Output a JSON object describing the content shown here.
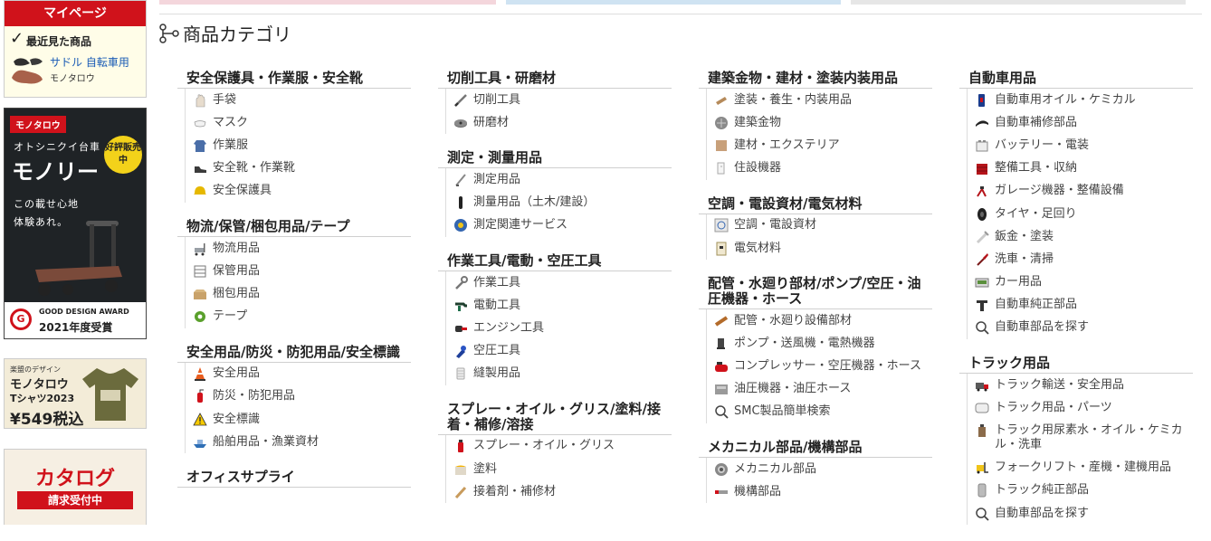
{
  "sidebar": {
    "mypage_label": "マイページ",
    "recent_label": "最近見た商品",
    "recent_item": {
      "name": "サドル 自転車用",
      "brand": "モノタロウ"
    },
    "banner_cart": {
      "logo": "モノタロウ",
      "subtitle": "オトシニクイ台車",
      "title": "モノリー",
      "badge": "好評販売中",
      "copy": "この載せ心地\n体験あれ。",
      "award_line1": "GOOD DESIGN AWARD",
      "award_line2": "2021年度受賞"
    },
    "banner_shirt": {
      "line1": "楽盟のデザイン",
      "line2": "モノタロウ",
      "line3": "Tシャツ2023",
      "price": "¥549税込"
    },
    "banner_catalog": {
      "title": "カタログ",
      "request": "請求受付中"
    }
  },
  "section": {
    "title": "商品カテゴリ"
  },
  "columns": [
    [
      {
        "title": "安全保護具・作業服・安全靴",
        "items": [
          {
            "label": "手袋",
            "icon": "glove-icon"
          },
          {
            "label": "マスク",
            "icon": "mask-icon"
          },
          {
            "label": "作業服",
            "icon": "workwear-icon"
          },
          {
            "label": "安全靴・作業靴",
            "icon": "shoe-icon"
          },
          {
            "label": "安全保護具",
            "icon": "helmet-icon"
          }
        ]
      },
      {
        "title": "物流/保管/梱包用品/テープ",
        "items": [
          {
            "label": "物流用品",
            "icon": "cart-icon"
          },
          {
            "label": "保管用品",
            "icon": "shelf-icon"
          },
          {
            "label": "梱包用品",
            "icon": "box-icon"
          },
          {
            "label": "テープ",
            "icon": "tape-icon"
          }
        ]
      },
      {
        "title": "安全用品/防災・防犯用品/安全標識",
        "items": [
          {
            "label": "安全用品",
            "icon": "cone-icon"
          },
          {
            "label": "防災・防犯用品",
            "icon": "extinguisher-icon"
          },
          {
            "label": "安全標識",
            "icon": "warning-sign-icon"
          },
          {
            "label": "船舶用品・漁業資材",
            "icon": "ship-icon"
          }
        ]
      },
      {
        "title": "オフィスサプライ",
        "items": []
      }
    ],
    [
      {
        "title": "切削工具・研磨材",
        "items": [
          {
            "label": "切削工具",
            "icon": "drill-bit-icon"
          },
          {
            "label": "研磨材",
            "icon": "grinding-disc-icon"
          }
        ]
      },
      {
        "title": "測定・測量用品",
        "items": [
          {
            "label": "測定用品",
            "icon": "caliper-icon"
          },
          {
            "label": "測量用品（土木/建設）",
            "icon": "survey-pole-icon"
          },
          {
            "label": "測定関連サービス",
            "icon": "service-icon"
          }
        ]
      },
      {
        "title": "作業工具/電動・空圧工具",
        "items": [
          {
            "label": "作業工具",
            "icon": "wrench-icon"
          },
          {
            "label": "電動工具",
            "icon": "power-drill-icon"
          },
          {
            "label": "エンジン工具",
            "icon": "chainsaw-icon"
          },
          {
            "label": "空圧工具",
            "icon": "air-tool-icon"
          },
          {
            "label": "縫製用品",
            "icon": "thread-icon"
          }
        ]
      },
      {
        "title": "スプレー・オイル・グリス/塗料/接着・補修/溶接",
        "items": [
          {
            "label": "スプレー・オイル・グリス",
            "icon": "spray-icon"
          },
          {
            "label": "塗料",
            "icon": "paint-icon"
          },
          {
            "label": "接着剤・補修材",
            "icon": "glue-icon"
          }
        ]
      }
    ],
    [
      {
        "title": "建築金物・建材・塗装内装用品",
        "items": [
          {
            "label": "塗装・養生・内装用品",
            "icon": "trowel-icon"
          },
          {
            "label": "建築金物",
            "icon": "hardware-icon"
          },
          {
            "label": "建材・エクステリア",
            "icon": "board-icon"
          },
          {
            "label": "住設機器",
            "icon": "faucet-icon"
          }
        ]
      },
      {
        "title": "空調・電設資材/電気材料",
        "items": [
          {
            "label": "空調・電設資材",
            "icon": "fan-icon"
          },
          {
            "label": "電気材料",
            "icon": "breaker-icon"
          }
        ]
      },
      {
        "title": "配管・水廻り部材/ポンプ/空圧・油圧機器・ホース",
        "items": [
          {
            "label": "配管・水廻り設備部材",
            "icon": "pipe-icon"
          },
          {
            "label": "ポンプ・送風機・電熱機器",
            "icon": "pump-icon"
          },
          {
            "label": "コンプレッサー・空圧機器・ホース",
            "icon": "compressor-icon"
          },
          {
            "label": "油圧機器・油圧ホース",
            "icon": "hydraulic-icon"
          },
          {
            "label": "SMC製品簡単検索",
            "icon": "search-icon"
          }
        ]
      },
      {
        "title": "メカニカル部品/機構部品",
        "items": [
          {
            "label": "メカニカル部品",
            "icon": "bearing-icon"
          },
          {
            "label": "機構部品",
            "icon": "mechanism-icon"
          }
        ]
      }
    ],
    [
      {
        "title": "自動車用品",
        "items": [
          {
            "label": "自動車用オイル・ケミカル",
            "icon": "oil-can-icon"
          },
          {
            "label": "自動車補修部品",
            "icon": "wiper-icon"
          },
          {
            "label": "バッテリー・電装",
            "icon": "battery-icon"
          },
          {
            "label": "整備工具・収納",
            "icon": "toolbox-icon"
          },
          {
            "label": "ガレージ機器・整備設備",
            "icon": "jack-icon"
          },
          {
            "label": "タイヤ・足回り",
            "icon": "tire-icon"
          },
          {
            "label": "鈑金・塗装",
            "icon": "spray-gun-icon"
          },
          {
            "label": "洗車・清掃",
            "icon": "brush-icon"
          },
          {
            "label": "カー用品",
            "icon": "car-goods-icon"
          },
          {
            "label": "自動車純正部品",
            "icon": "genuine-part-icon"
          },
          {
            "label": "自動車部品を探す",
            "icon": "search-icon"
          }
        ]
      },
      {
        "title": "トラック用品",
        "items": [
          {
            "label": "トラック輸送・安全用品",
            "icon": "truck-icon"
          },
          {
            "label": "トラック用品・パーツ",
            "icon": "truck-part-icon"
          },
          {
            "label": "トラック用尿素水・オイル・ケミカル・洗車",
            "icon": "urea-icon"
          },
          {
            "label": "フォークリフト・産機・建機用品",
            "icon": "forklift-icon"
          },
          {
            "label": "トラック純正部品",
            "icon": "genuine-truck-icon"
          },
          {
            "label": "自動車部品を探す",
            "icon": "search-icon"
          }
        ]
      }
    ]
  ]
}
